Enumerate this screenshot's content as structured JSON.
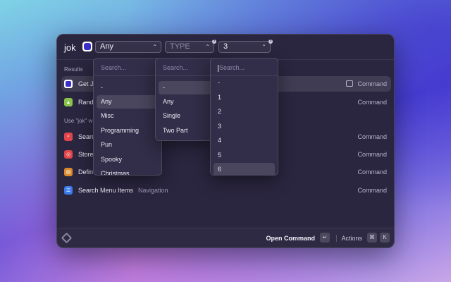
{
  "search": {
    "text": "jok"
  },
  "filters": [
    {
      "value": "Any",
      "is_placeholder": false
    },
    {
      "value": "TYPE",
      "is_placeholder": true
    },
    {
      "value": "3",
      "is_placeholder": false
    }
  ],
  "sections": {
    "results": "Results",
    "fallback": "Use \"jok\" w"
  },
  "rows": [
    {
      "title": "Get J",
      "subtitle": "",
      "accessory": "Command",
      "icon": "jokes-extension-icon",
      "color": "#3a2fc9"
    },
    {
      "title": "Rando",
      "subtitle": "",
      "accessory": "Command",
      "icon": "random-icon",
      "color": "#8bc34a"
    },
    {
      "title": "Search",
      "subtitle": "",
      "accessory": "Command",
      "icon": "search-icon",
      "color": "#e0454a"
    },
    {
      "title": "Store",
      "subtitle": "",
      "accessory": "Command",
      "icon": "store-icon",
      "color": "#e0454a"
    },
    {
      "title": "Defin",
      "subtitle": "",
      "accessory": "Command",
      "icon": "book-icon",
      "color": "#d98a2b"
    },
    {
      "title": "Search Menu Items",
      "subtitle": "Navigation",
      "accessory": "Command",
      "icon": "menu-items-icon",
      "color": "#3b7bea"
    }
  ],
  "bottom": {
    "primary_action": "Open Command",
    "enter_key": "↵",
    "actions_label": "Actions",
    "cmd_key": "⌘",
    "k_key": "K"
  },
  "menus": [
    {
      "search_placeholder": "Search...",
      "options": [
        "-",
        "Any",
        "Misc",
        "Programming",
        "Pun",
        "Spooky",
        "Christmas"
      ],
      "selected": "Any"
    },
    {
      "search_placeholder": "Search...",
      "options": [
        "-",
        "Any",
        "Single",
        "Two Part"
      ],
      "selected": "-"
    },
    {
      "search_placeholder": "Search...",
      "options": [
        "-",
        "1",
        "2",
        "3",
        "4",
        "5",
        "6"
      ],
      "selected": "6"
    }
  ]
}
